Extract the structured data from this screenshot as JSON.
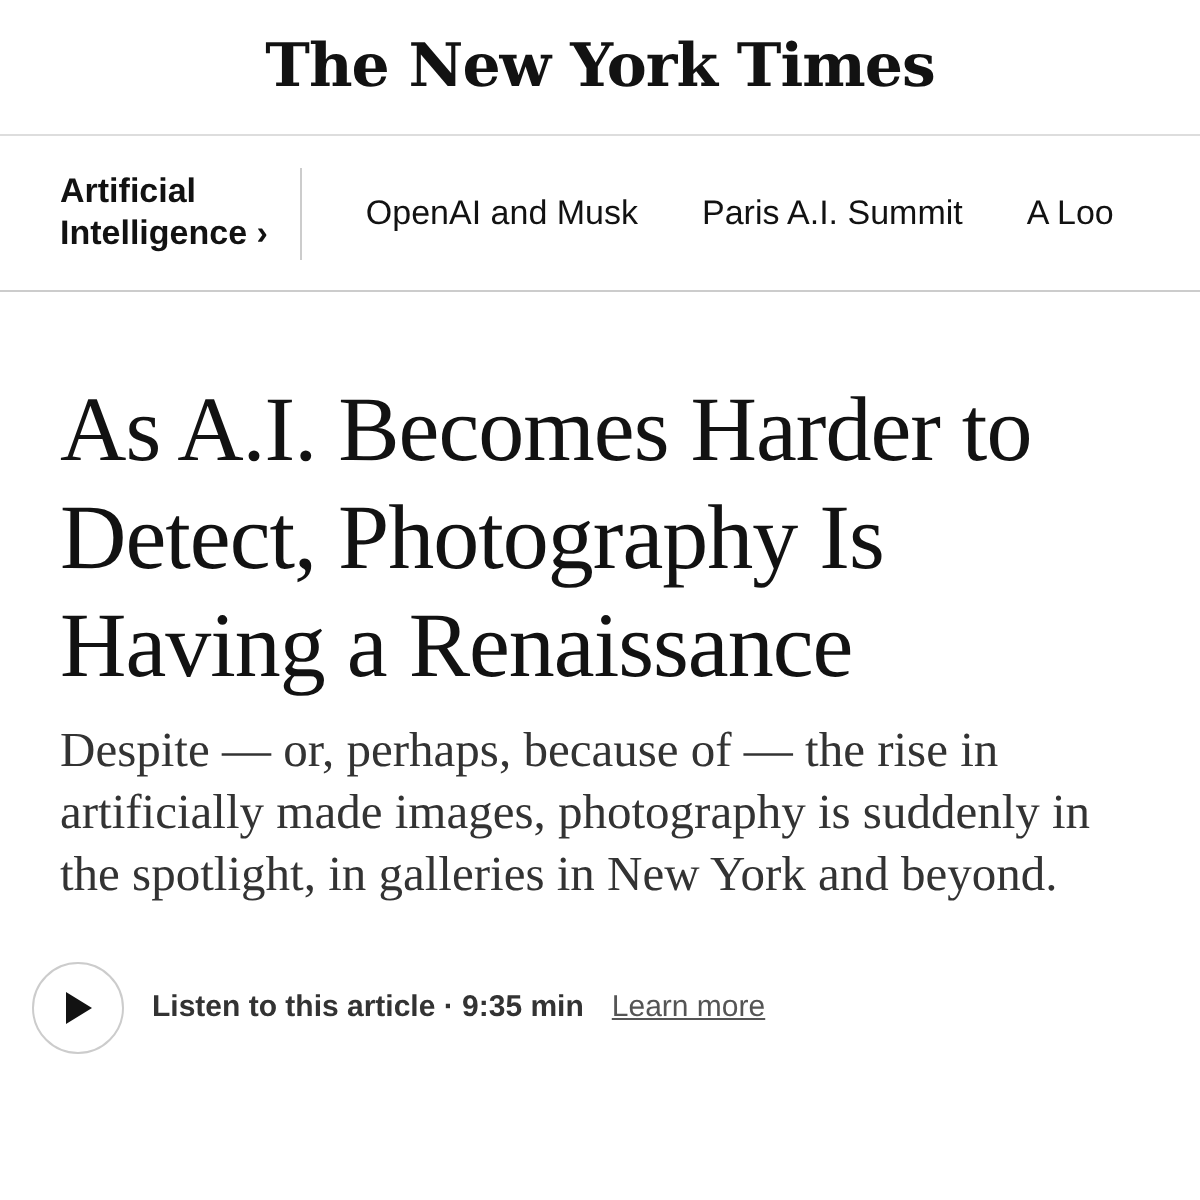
{
  "masthead": {
    "logo": "The New York Times"
  },
  "topic_nav": {
    "section": {
      "label": "Artificial Intelligence",
      "chevron": "›"
    },
    "links": [
      {
        "label": "OpenAI and Musk"
      },
      {
        "label": "Paris A.I. Summit"
      },
      {
        "label": "A Loo"
      }
    ]
  },
  "article": {
    "headline": "As A.I. Becomes Harder to Detect, Photography Is Having a Renaissance",
    "summary": "Despite — or, perhaps, because of — the rise in artificially made images, photography is suddenly in the spotlight, in galleries in New York and beyond.",
    "audio": {
      "label": "Listen to this article · 9:35 min",
      "link": "Learn more"
    }
  }
}
